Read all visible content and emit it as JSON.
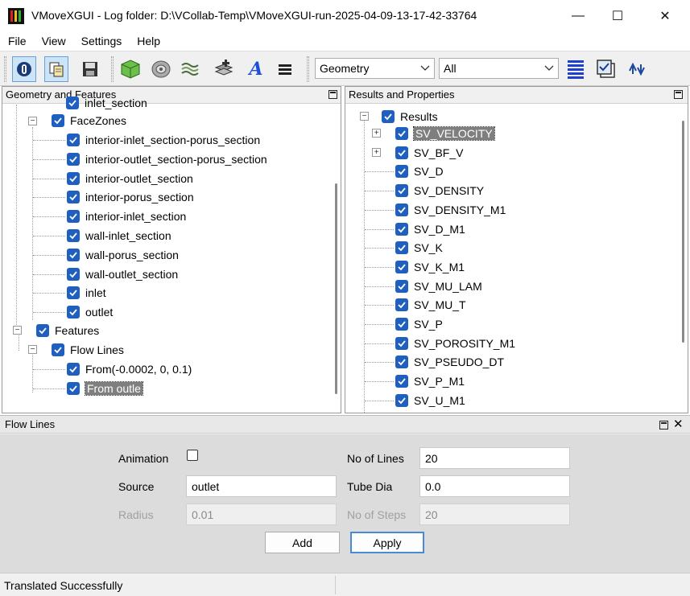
{
  "window": {
    "title": "VMoveXGUI - Log folder: D:\\VCollab-Temp\\VMoveXGUI-run-2025-04-09-13-17-42-33764",
    "minimize": "—",
    "maximize": "☐",
    "close": "✕"
  },
  "menu": [
    "File",
    "View",
    "Settings",
    "Help"
  ],
  "toolbar": {
    "mode_select": "Geometry",
    "filter_select": "All",
    "icons": [
      "vcollab-logo-icon",
      "copy-icon",
      "save-icon",
      "cube-icon",
      "disc-icon",
      "layers-wave-icon",
      "add-stack-icon",
      "text-icon",
      "stack-icon",
      "list-icon",
      "checkbox-window-icon",
      "swap-arrows-icon"
    ]
  },
  "geometry_panel": {
    "title": "Geometry and Features",
    "partial_top": "inlet_section",
    "facezones_label": "FaceZones",
    "facezones": [
      "interior-inlet_section-porus_section",
      "interior-outlet_section-porus_section",
      "interior-outlet_section",
      "interior-porus_section",
      "interior-inlet_section",
      "wall-inlet_section",
      "wall-porus_section",
      "wall-outlet_section",
      "inlet",
      "outlet"
    ],
    "features_label": "Features",
    "flowlines_label": "Flow Lines",
    "flowlines": [
      "From(-0.0002, 0, 0.1)",
      "From outle"
    ]
  },
  "results_panel": {
    "title": "Results and Properties",
    "root_label": "Results",
    "items": [
      "SV_VELOCITY",
      "SV_BF_V",
      "SV_D",
      "SV_DENSITY",
      "SV_DENSITY_M1",
      "SV_D_M1",
      "SV_K",
      "SV_K_M1",
      "SV_MU_LAM",
      "SV_MU_T",
      "SV_P",
      "SV_POROSITY_M1",
      "SV_PSEUDO_DT",
      "SV_P_M1",
      "SV_U_M1"
    ]
  },
  "flow_lines_panel": {
    "title": "Flow Lines",
    "animation_label": "Animation",
    "animation_checked": false,
    "source_label": "Source",
    "source_value": "outlet",
    "radius_label": "Radius",
    "radius_value": "0.01",
    "no_of_lines_label": "No of Lines",
    "no_of_lines_value": "20",
    "tube_dia_label": "Tube Dia",
    "tube_dia_value": "0.0",
    "no_of_steps_label": "No of Steps",
    "no_of_steps_value": "20",
    "add_label": "Add",
    "apply_label": "Apply"
  },
  "status": {
    "message": "Translated Successfully"
  },
  "colors": {
    "checkbox": "#1f5fbf",
    "selection": "#7f7f7f",
    "default_button_border": "#4a8ad4"
  }
}
